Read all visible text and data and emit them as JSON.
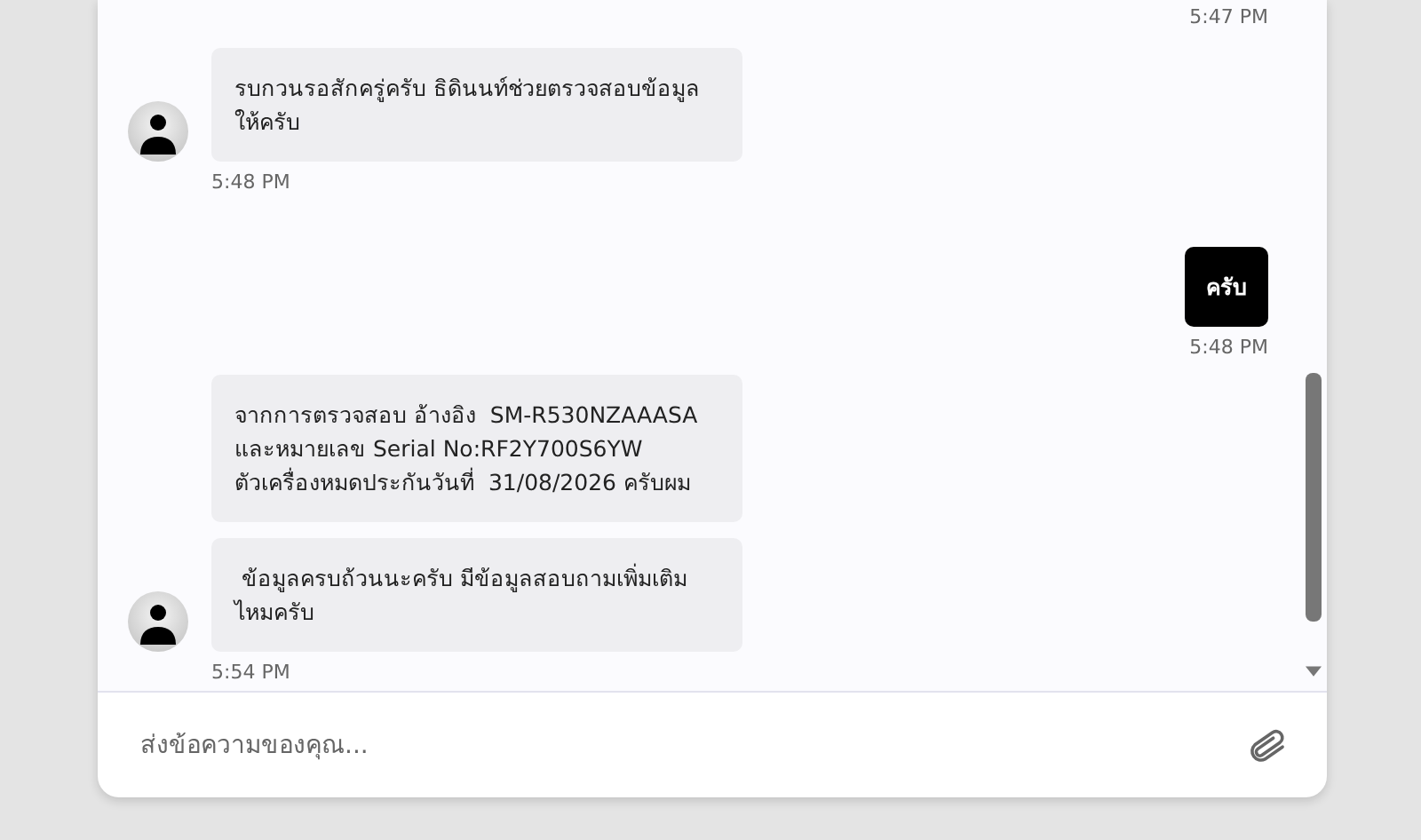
{
  "chat": {
    "messages": [
      {
        "kind": "time_only",
        "time": "5:47 PM"
      },
      {
        "kind": "incoming",
        "avatar": true,
        "text": "รบกวนรอสักครู่ครับ ธิดินนท์ช่วยตรวจสอบข้อมูลให้ครับ",
        "time": "5:48 PM"
      },
      {
        "kind": "outgoing",
        "text": "ครับ",
        "time": "5:48 PM"
      },
      {
        "kind": "incoming",
        "avatar": false,
        "text": "จากการตรวจสอบ อ้างอิง  SM-R530NZAAASA\nและหมายเลข Serial No:RF2Y700S6YW\nตัวเครื่องหมดประกันวันที่  31/08/2026 ครับผม"
      },
      {
        "kind": "incoming",
        "avatar": true,
        "text": " ข้อมูลครบถ้วนนะครับ มีข้อมูลสอบถามเพิ่มเติมไหมครับ",
        "time": "5:54 PM"
      }
    ]
  },
  "composer": {
    "placeholder": "ส่งข้อความของคุณ..."
  }
}
